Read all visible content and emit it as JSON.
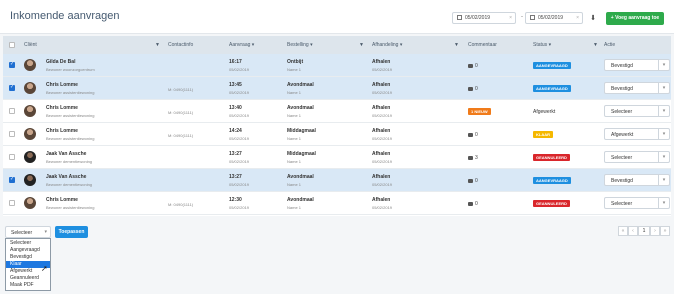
{
  "header": {
    "title": "Inkomende aanvragen",
    "date_from": "05/02/2019",
    "date_to": "05/02/2019",
    "date_separator": "-",
    "clear_glyph": "×",
    "download_glyph": "⬇",
    "new_button": "+ Voeg aanvraag toe",
    "accent_color": "#2eaa4b"
  },
  "table": {
    "columns": [
      "Cliënt",
      "Contactinfo",
      "Aanvraag",
      "Bestelling",
      "Afhandeling",
      "Commentaar",
      "Status",
      "Actie"
    ],
    "sort_glyph": "▾",
    "filter_glyph": "▼",
    "rows": [
      {
        "selected": true,
        "name": "Gilda De Bal",
        "sub": "Bewoner woonzorgcentrum",
        "contact": "",
        "time": "16:17",
        "date": "05/02/2019",
        "meal": "Ontbijt",
        "meal_sub": "Name 1",
        "afh": "Afhalen",
        "afh_sub": "05/02/2019",
        "comment": "0",
        "status": "AANGEVRAAGD",
        "status_color": "#1e8fe0",
        "action": "Bevestigd"
      },
      {
        "selected": true,
        "name": "Chris Lomme",
        "sub": "Bewoner assistentiewoning",
        "contact": "M: 0490(1111)",
        "time": "13:45",
        "date": "05/02/2019",
        "meal": "Avondmaal",
        "meal_sub": "Name 1",
        "afh": "Afhalen",
        "afh_sub": "05/02/2019",
        "comment": "0",
        "status": "AANGEVRAAGD",
        "status_color": "#1e8fe0",
        "action": "Bevestigd"
      },
      {
        "selected": false,
        "name": "Chris Lomme",
        "sub": "Bewoner assistentiewoning",
        "contact": "M: 0490(1111)",
        "time": "13:40",
        "date": "05/02/2019",
        "meal": "Avondmaal",
        "meal_sub": "Name 1",
        "afh": "Afhalen",
        "afh_sub": "05/02/2019",
        "comment": "1 NIEUW",
        "status": "Afgewerkt",
        "status_color": "",
        "action": "Selecteer"
      },
      {
        "selected": false,
        "name": "Chris Lomme",
        "sub": "Bewoner assistentiewoning",
        "contact": "M: 0490(1111)",
        "time": "14:24",
        "date": "05/02/2019",
        "meal": "Middagmaal",
        "meal_sub": "Name 1",
        "afh": "Afhalen",
        "afh_sub": "05/02/2019",
        "comment": "0",
        "status": "KLAAR",
        "status_color": "#f5b800",
        "action": "Afgewerkt"
      },
      {
        "selected": false,
        "name": "Jaak Van Assche",
        "sub": "Bewoner dementiewoning",
        "contact": "",
        "time": "13:27",
        "date": "05/02/2019",
        "meal": "Middagmaal",
        "meal_sub": "Name 1",
        "afh": "Afhalen",
        "afh_sub": "05/02/2019",
        "comment": "3",
        "status": "GEANNULEERD",
        "status_color": "#d9262b",
        "action": "Selecteer"
      },
      {
        "selected": true,
        "name": "Jaak Van Assche",
        "sub": "Bewoner dementiewoning",
        "contact": "",
        "time": "13:27",
        "date": "05/02/2019",
        "meal": "Avondmaal",
        "meal_sub": "Name 1",
        "afh": "Afhalen",
        "afh_sub": "05/02/2019",
        "comment": "0",
        "status": "AANGEVRAAGD",
        "status_color": "#1e8fe0",
        "action": "Bevestigd"
      },
      {
        "selected": false,
        "name": "Chris Lomme",
        "sub": "Bewoner assistentiewoning",
        "contact": "M: 0490(1111)",
        "time": "12:30",
        "date": "05/02/2019",
        "meal": "Avondmaal",
        "meal_sub": "Name 1",
        "afh": "Afhalen",
        "afh_sub": "05/02/2019",
        "comment": "0",
        "status": "GEANNULEERD",
        "status_color": "#d9262b",
        "action": "Selecteer"
      }
    ]
  },
  "bulk": {
    "select_value": "Selecteer",
    "apply_label": "Toepassen",
    "options": [
      "Selecteer",
      "Aangevraagd",
      "Bevestigd",
      "Klaar",
      "Afgewerkt",
      "Geannuleerd",
      "Maak PDF"
    ],
    "highlighted_option": "Klaar"
  },
  "pagination": {
    "first": "«",
    "prev": "‹",
    "current": "1",
    "next": "›",
    "last": "»"
  }
}
